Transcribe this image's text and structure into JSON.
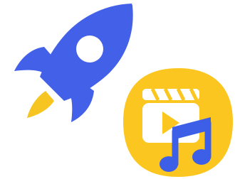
{
  "icons": {
    "rocket": "rocket-icon",
    "badge": "video-music-icon",
    "clapperboard": "clapperboard-icon",
    "play": "play-icon",
    "music_note": "music-note-icon"
  },
  "colors": {
    "rocket_blue": "#4361e8",
    "flame_yellow": "#f6c521",
    "badge_yellow": "#fcc620",
    "white": "#ffffff",
    "note_blue": "#3d5ee6"
  }
}
